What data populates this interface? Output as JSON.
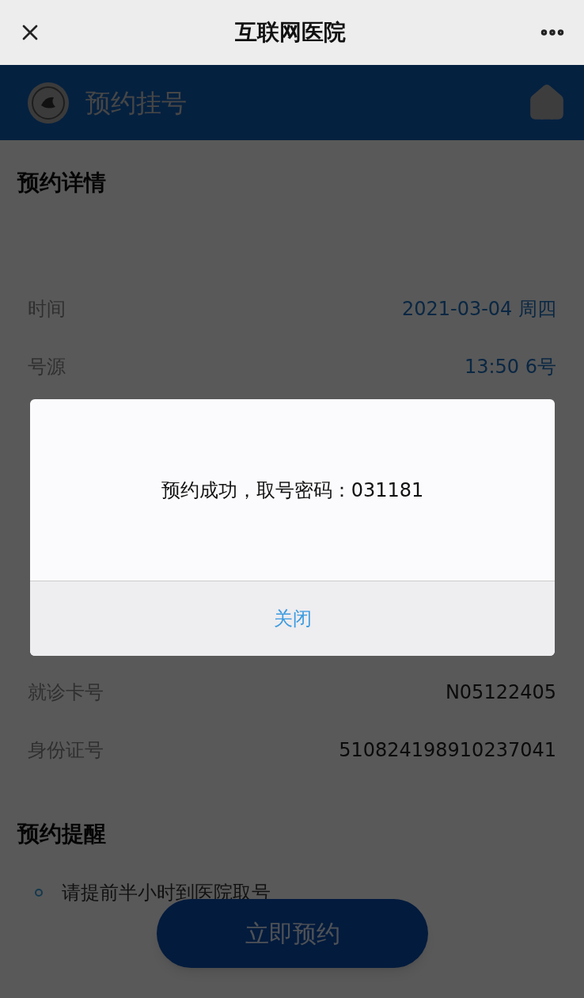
{
  "top_bar": {
    "title": "互联网医院"
  },
  "header": {
    "title": "预约挂号"
  },
  "details": {
    "heading": "预约详情",
    "rows": [
      {
        "label": "时间",
        "value": "2021-03-04 周四"
      },
      {
        "label": "号源",
        "value": "13:50 6号"
      }
    ]
  },
  "patient": {
    "rows": [
      {
        "label": "就诊卡号",
        "value": "N05122405"
      },
      {
        "label": "身份证号",
        "value": "510824198910237041"
      }
    ]
  },
  "reminder": {
    "heading": "预约提醒",
    "items": [
      "请提前半小时到医院取号"
    ]
  },
  "submit_button": "立即预约",
  "dialog": {
    "message": "预约成功，取号密码：031181",
    "button": "关闭"
  }
}
